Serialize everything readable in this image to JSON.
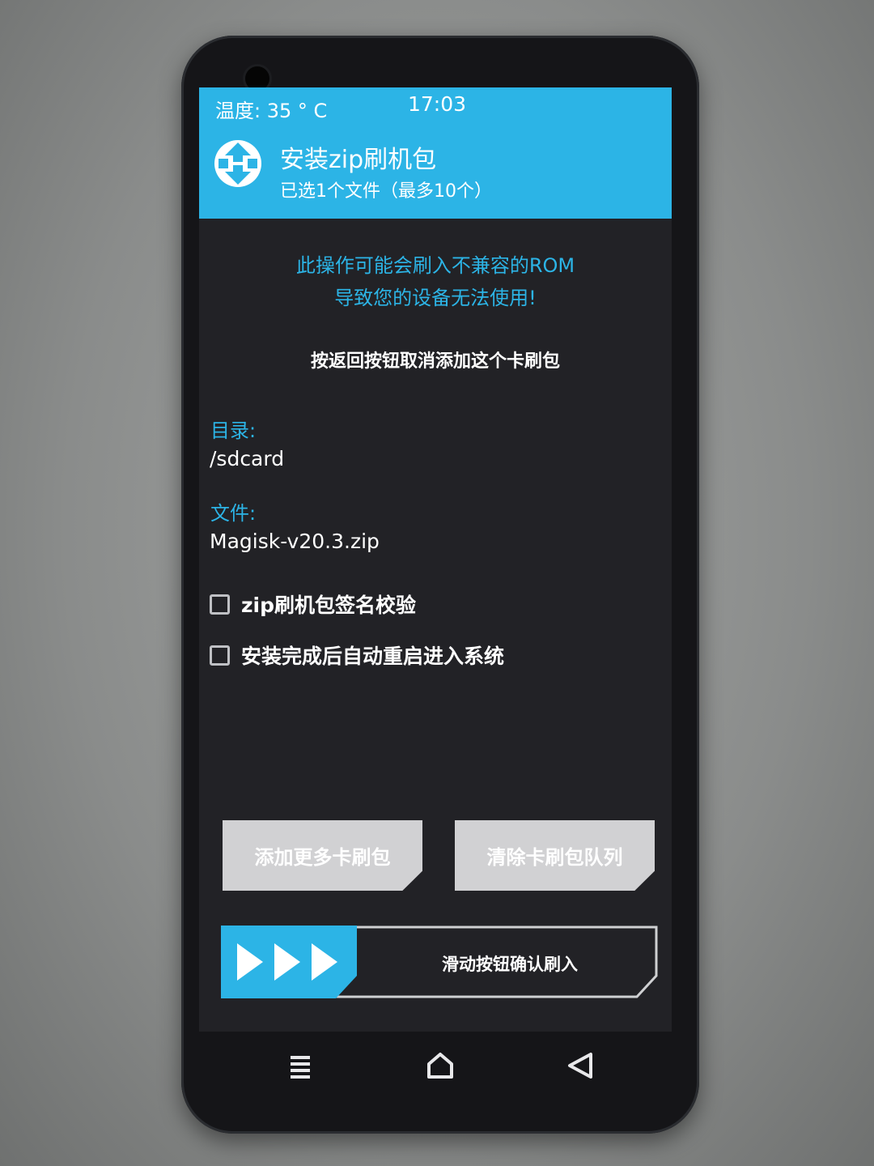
{
  "status": {
    "temperature": "温度: 35 ° C",
    "time": "17:03"
  },
  "header": {
    "logo_icon": "twrp-logo-icon",
    "title": "安装zip刷机包",
    "subtitle": "已选1个文件（最多10个）"
  },
  "warning": {
    "line1": "此操作可能会刷入不兼容的ROM",
    "line2": "导致您的设备无法使用!"
  },
  "back_note": "按返回按钮取消添加这个卡刷包",
  "directory": {
    "label": "目录:",
    "value": "/sdcard"
  },
  "file": {
    "label": "文件:",
    "value": "Magisk-v20.3.zip"
  },
  "options": [
    {
      "label": "zip刷机包签名校验",
      "checked": false
    },
    {
      "label": "安装完成后自动重启进入系统",
      "checked": false
    }
  ],
  "buttons": {
    "add_more": "添加更多卡刷包",
    "clear_queue": "清除卡刷包队列"
  },
  "slider": {
    "label": "滑动按钮确认刷入",
    "handle_icon": "triple-arrow-right-icon"
  },
  "nav": {
    "menu_icon": "menu-icon",
    "home_icon": "home-icon",
    "back_icon": "back-triangle-icon"
  },
  "colors": {
    "accent": "#2cb4e6",
    "background": "#222226",
    "button": "#d1d1d3"
  }
}
